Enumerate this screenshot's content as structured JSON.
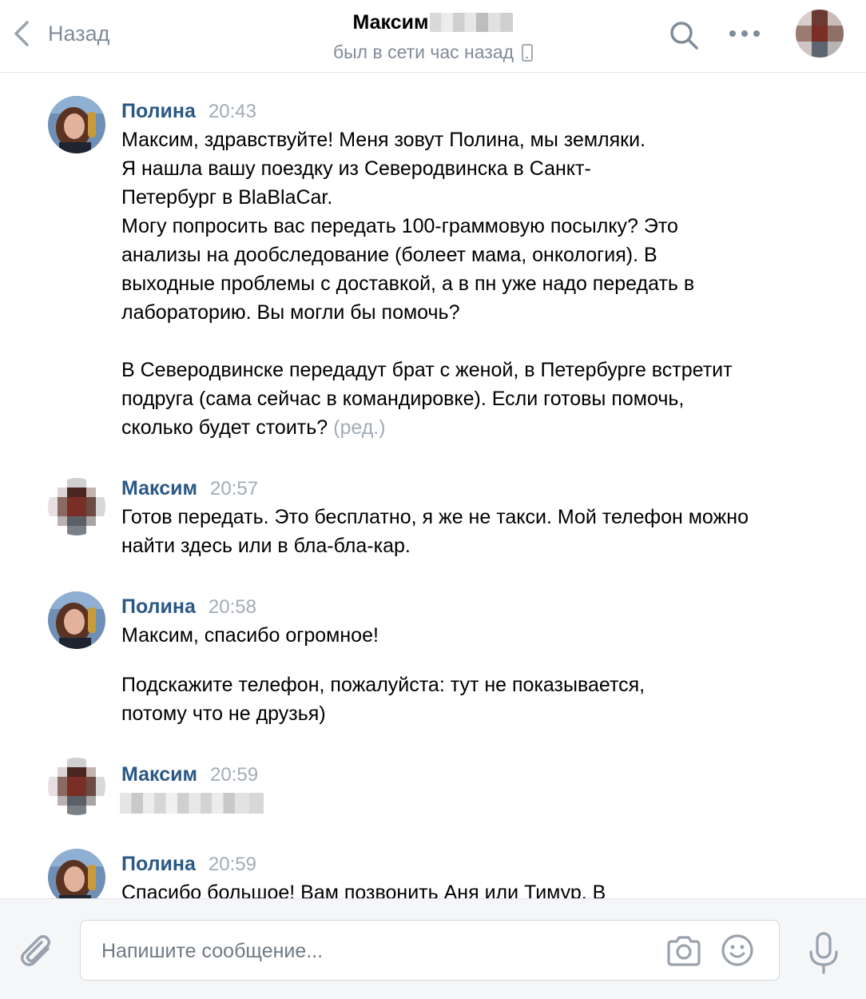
{
  "header": {
    "back_label": "Назад",
    "title": "Максим",
    "status": "был в сети час назад"
  },
  "messages": [
    {
      "author": "Полина",
      "time": "20:43",
      "paragraphs": [
        "Максим, здравствуйте! Меня зовут Полина, мы земляки.",
        "Я нашла вашу поездку из Северодвинска в Санкт-Петербург в BlaBlaCar.",
        "Могу попросить вас передать 100-граммовую посылку? Это анализы на дообследование (болеет мама, онкология). В выходные проблемы с доставкой, а в пн уже надо передать в лабораторию. Вы могли бы помочь?",
        "В Северодвинске передадут брат с женой, в Петербурге встретит подруга (сама сейчас в командировке). Если готовы помочь, сколько будет стоить?"
      ],
      "edited": "(ред.)"
    },
    {
      "author": "Максим",
      "time": "20:57",
      "paragraphs": [
        "Готов передать. Это бесплатно, я же не такси. Мой телефон можно найти здесь или в бла-бла-кар."
      ]
    },
    {
      "author": "Полина",
      "time": "20:58",
      "paragraphs": [
        "Максим, спасибо огромное!",
        "Подскажите телефон, пожалуйста: тут не показывается, потому что не друзья)"
      ]
    },
    {
      "author": "Максим",
      "time": "20:59",
      "paragraphs": []
    },
    {
      "author": "Полина",
      "time": "20:59",
      "paragraphs": [
        "Спасибо большое! Вам позвонить Аня или Тимур. В"
      ]
    }
  ],
  "composer": {
    "placeholder": "Напишите сообщение..."
  },
  "colors": {
    "author": "#2a5885",
    "muted": "#818c99",
    "time": "#a3abb5",
    "composer_bg": "#f5f6f8"
  },
  "icons": [
    "chevron-left-icon",
    "search-icon",
    "more-icon",
    "phone-icon",
    "paperclip-icon",
    "camera-icon",
    "smile-icon",
    "microphone-icon"
  ]
}
